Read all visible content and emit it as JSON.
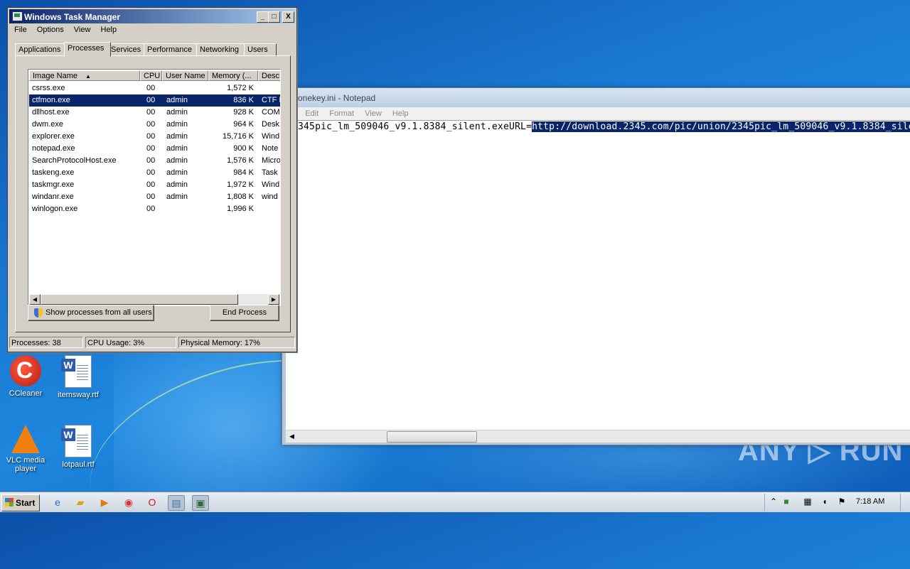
{
  "notepad": {
    "title": "onekey.ini - Notepad",
    "menu": [
      "e",
      "Edit",
      "Format",
      "View",
      "Help"
    ],
    "text_plain": "345pic_lm_509046_v9.1.8384_silent.exeURL=",
    "text_selected": "http://download.2345.com/pic/union/2345pic_lm_509046_v9.1.8384_sile"
  },
  "taskmgr": {
    "title": "Windows Task Manager",
    "controls": {
      "minimize": "_",
      "maximize": "□",
      "close": "X"
    },
    "menu": [
      "File",
      "Options",
      "View",
      "Help"
    ],
    "tabs": [
      "Applications",
      "Processes",
      "Services",
      "Performance",
      "Networking",
      "Users"
    ],
    "active_tab": "Processes",
    "columns": [
      "Image Name",
      "CPU",
      "User Name",
      "Memory (...",
      "Desc"
    ],
    "sort_indicator": "▲",
    "processes": [
      {
        "name": "csrss.exe",
        "cpu": "00",
        "user": "",
        "mem": "1,572 K",
        "desc": ""
      },
      {
        "name": "ctfmon.exe",
        "cpu": "00",
        "user": "admin",
        "mem": "836 K",
        "desc": "CTF L"
      },
      {
        "name": "dllhost.exe",
        "cpu": "00",
        "user": "admin",
        "mem": "928 K",
        "desc": "COM"
      },
      {
        "name": "dwm.exe",
        "cpu": "00",
        "user": "admin",
        "mem": "964 K",
        "desc": "Desk"
      },
      {
        "name": "explorer.exe",
        "cpu": "00",
        "user": "admin",
        "mem": "15,716 K",
        "desc": "Wind"
      },
      {
        "name": "notepad.exe",
        "cpu": "00",
        "user": "admin",
        "mem": "900 K",
        "desc": "Note"
      },
      {
        "name": "SearchProtocolHost.exe",
        "cpu": "00",
        "user": "admin",
        "mem": "1,576 K",
        "desc": "Micro"
      },
      {
        "name": "taskeng.exe",
        "cpu": "00",
        "user": "admin",
        "mem": "984 K",
        "desc": "Task"
      },
      {
        "name": "taskmgr.exe",
        "cpu": "00",
        "user": "admin",
        "mem": "1,972 K",
        "desc": "Wind"
      },
      {
        "name": "windanr.exe",
        "cpu": "00",
        "user": "admin",
        "mem": "1,808 K",
        "desc": "wind"
      },
      {
        "name": "winlogon.exe",
        "cpu": "00",
        "user": "",
        "mem": "1,996 K",
        "desc": ""
      }
    ],
    "selected_process": "ctfmon.exe",
    "show_all_button": "Show processes from all users",
    "end_process_button": "End Process",
    "status": {
      "processes": "Processes: 38",
      "cpu": "CPU Usage: 3%",
      "memory": "Physical Memory: 17%"
    }
  },
  "desktop": {
    "icons": [
      {
        "label": "CCleaner",
        "icon": "ccleaner-icon"
      },
      {
        "label": "itemsway.rtf",
        "icon": "word-document-icon"
      },
      {
        "label": "VLC media player",
        "icon": "vlc-icon"
      },
      {
        "label": "lotpaul.rtf",
        "icon": "word-document-icon"
      }
    ],
    "watermark": "ANY ▷ RUN"
  },
  "taskbar": {
    "start_label": "Start",
    "pinned": [
      "ie-icon",
      "explorer-icon",
      "media-player-icon",
      "chrome-icon",
      "opera-icon",
      "notepad-icon",
      "task-manager-icon"
    ],
    "clock": "7:18 AM"
  }
}
